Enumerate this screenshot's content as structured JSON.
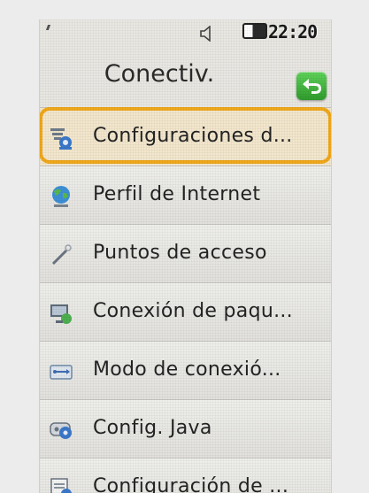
{
  "status": {
    "time": "22:20",
    "icons": [
      "speaker-icon",
      "battery-icon"
    ]
  },
  "header": {
    "title": "Conectiv.",
    "back_icon": "back-arrow-icon"
  },
  "menu": {
    "items": [
      {
        "label": "Configuraciones d...",
        "icon": "network-settings-icon",
        "selected": true
      },
      {
        "label": "Perfil de Internet",
        "icon": "globe-icon"
      },
      {
        "label": "Puntos de acceso",
        "icon": "access-point-icon"
      },
      {
        "label": "Conexión de paqu...",
        "icon": "packet-connection-icon"
      },
      {
        "label": "Modo de conexió...",
        "icon": "usb-mode-icon"
      },
      {
        "label": "Config. Java",
        "icon": "java-settings-icon"
      },
      {
        "label": "Configuración de ...",
        "icon": "configuration-icon"
      }
    ]
  },
  "colors": {
    "highlight": "#f0a81b",
    "back_button": "#3aaf35"
  }
}
